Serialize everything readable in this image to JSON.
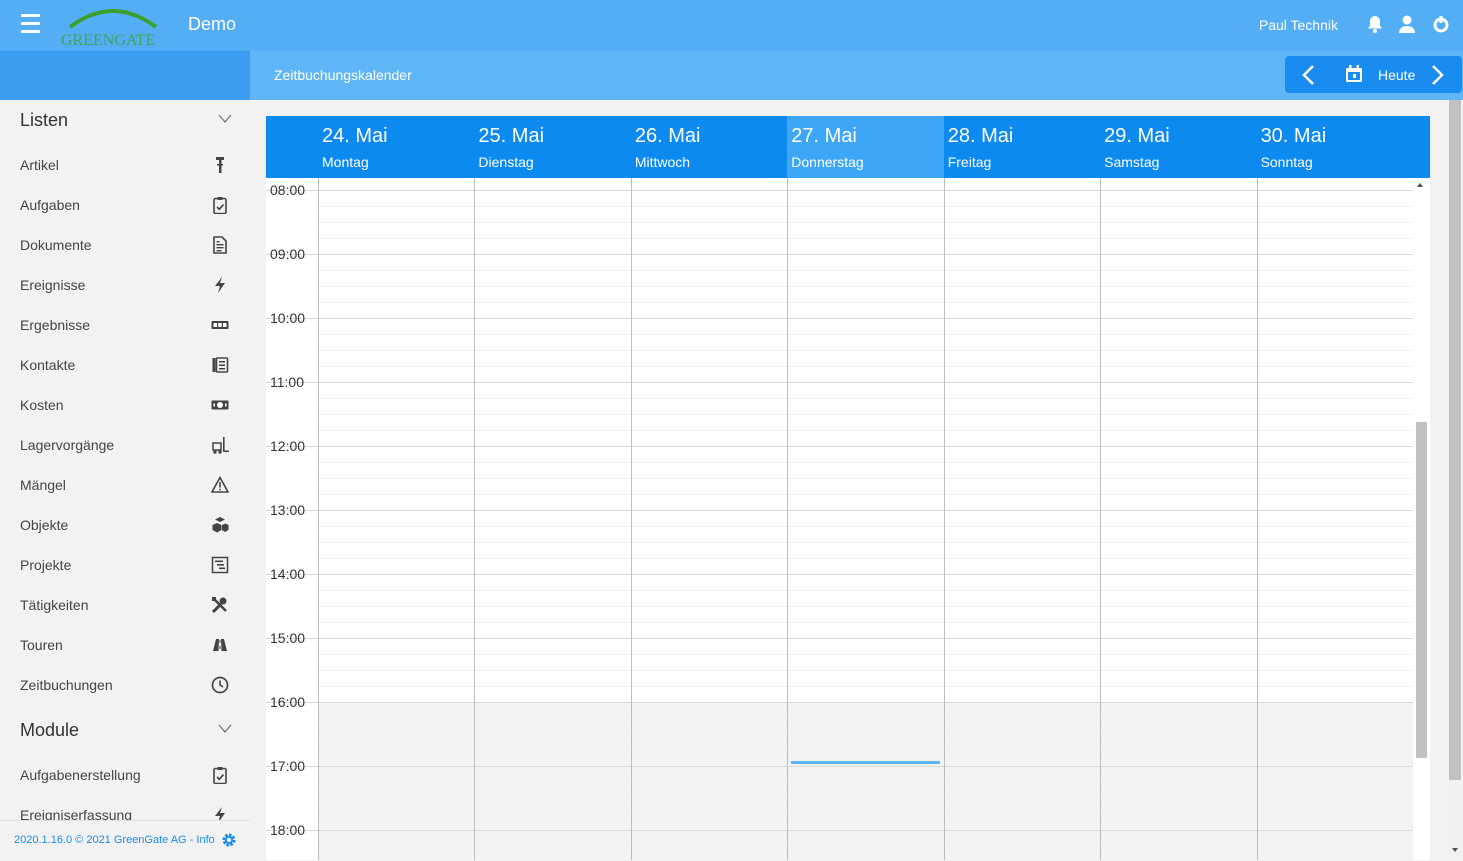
{
  "header": {
    "app_title": "Demo",
    "logo_text": "GREENGATE",
    "user_name": "Paul Technik",
    "colors": {
      "bar": "#54aef5",
      "accent": "#0d8af0",
      "logo_arc": "#3aa12d"
    }
  },
  "subheader": {
    "title": "Zeitbuchungskalender",
    "today_label": "Heute"
  },
  "sidebar": {
    "sections": [
      {
        "label": "Listen",
        "items": [
          {
            "label": "Artikel",
            "icon": "tools-icon"
          },
          {
            "label": "Aufgaben",
            "icon": "clipboard-check-icon"
          },
          {
            "label": "Dokumente",
            "icon": "document-icon"
          },
          {
            "label": "Ereignisse",
            "icon": "bolt-icon"
          },
          {
            "label": "Ergebnisse",
            "icon": "counter-icon"
          },
          {
            "label": "Kontakte",
            "icon": "address-book-icon"
          },
          {
            "label": "Kosten",
            "icon": "money-icon"
          },
          {
            "label": "Lagervorgänge",
            "icon": "forklift-icon"
          },
          {
            "label": "Mängel",
            "icon": "warning-icon"
          },
          {
            "label": "Objekte",
            "icon": "cubes-icon"
          },
          {
            "label": "Projekte",
            "icon": "project-icon"
          },
          {
            "label": "Tätigkeiten",
            "icon": "wrench-icon"
          },
          {
            "label": "Touren",
            "icon": "road-icon"
          },
          {
            "label": "Zeitbuchungen",
            "icon": "clock-icon"
          }
        ]
      },
      {
        "label": "Module",
        "items": [
          {
            "label": "Aufgabenerstellung",
            "icon": "clipboard-check-icon"
          },
          {
            "label": "Ereigniserfassung",
            "icon": "bolt-icon"
          }
        ]
      }
    ],
    "footer_text": "2020.1.16.0 © 2021 GreenGate AG - Info"
  },
  "calendar": {
    "days": [
      {
        "date": "24. Mai",
        "weekday": "Montag",
        "active": false
      },
      {
        "date": "25. Mai",
        "weekday": "Dienstag",
        "active": false
      },
      {
        "date": "26. Mai",
        "weekday": "Mittwoch",
        "active": false
      },
      {
        "date": "27. Mai",
        "weekday": "Donnerstag",
        "active": true
      },
      {
        "date": "28. Mai",
        "weekday": "Freitag",
        "active": false
      },
      {
        "date": "29. Mai",
        "weekday": "Samstag",
        "active": false
      },
      {
        "date": "30. Mai",
        "weekday": "Sonntag",
        "active": false
      }
    ],
    "hours": [
      "08:00",
      "09:00",
      "10:00",
      "11:00",
      "12:00",
      "13:00",
      "14:00",
      "15:00",
      "16:00",
      "17:00",
      "18:00"
    ],
    "now_marker_time": "16:55",
    "off_hours_start": "16:00",
    "colors": {
      "header": "#0d8af0",
      "active_header": "#3ea6f7",
      "now_marker": "#5eb6f7",
      "off_hours": "#f3f3f3"
    }
  }
}
